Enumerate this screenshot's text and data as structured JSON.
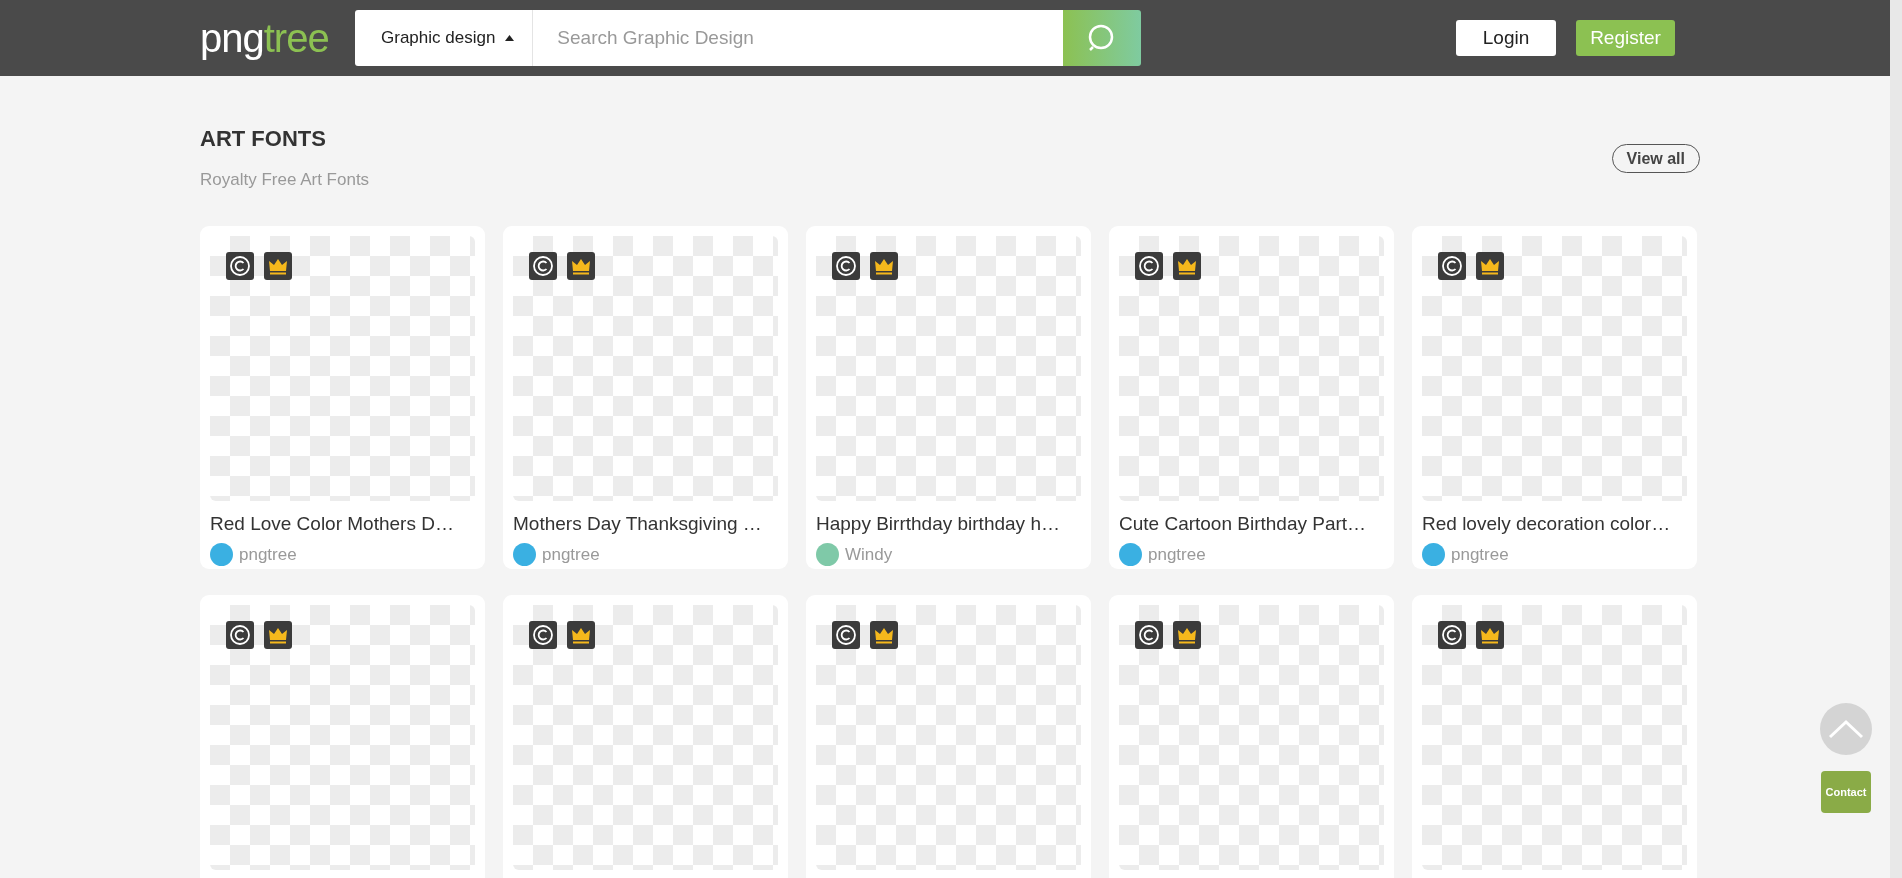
{
  "header": {
    "logo": [
      "png",
      "tree"
    ],
    "category": "Graphic design",
    "search_placeholder": "Search Graphic Design",
    "login": "Login",
    "register": "Register"
  },
  "section": {
    "title": "ART FONTS",
    "subtitle": "Royalty Free Art Fonts",
    "view_all": "View all"
  },
  "cards": [
    {
      "kind": "full",
      "title": "Red Love Color Mothers D…",
      "author": "pngtree",
      "color": "#3ab0e2"
    },
    {
      "kind": "full",
      "title": "Mothers Day Thanksgiving …",
      "author": "pngtree",
      "color": "#3ab0e2"
    },
    {
      "kind": "full",
      "title": "Happy Birrthday birthday h…",
      "author": "Windy",
      "color": "#7fc9a8"
    },
    {
      "kind": "full",
      "title": "Cute Cartoon Birthday Part…",
      "author": "pngtree",
      "color": "#3ab0e2"
    },
    {
      "kind": "full",
      "title": "Red lovely decoration color…",
      "author": "pngtree",
      "color": "#3ab0e2"
    },
    {
      "kind": "image"
    },
    {
      "kind": "image"
    },
    {
      "kind": "image"
    },
    {
      "kind": "image"
    },
    {
      "kind": "image"
    }
  ],
  "side": {
    "contact": "Contact"
  }
}
